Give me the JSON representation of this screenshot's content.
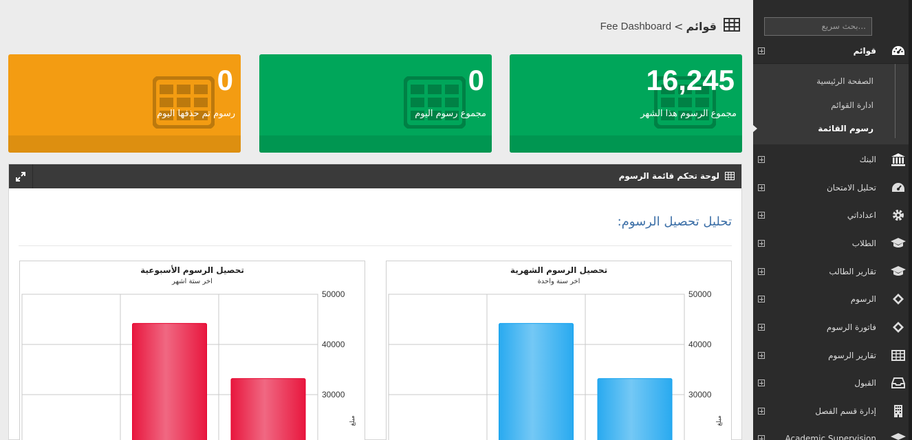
{
  "sidebar": {
    "search_placeholder": "...بحث سريع",
    "dashboard_label": "قوائم",
    "submenu": [
      "الصفحة الرئيسية",
      "ادارة القوائم",
      "رسوم القائمة"
    ],
    "items": [
      {
        "label": "البنك",
        "icon": "bank-icon"
      },
      {
        "label": "تحليل الامتحان",
        "icon": "dashboard-icon"
      },
      {
        "label": "اعداداتي",
        "icon": "gear-icon"
      },
      {
        "label": "الطلاب",
        "icon": "graduation-cap-icon"
      },
      {
        "label": "تقارير الطالب",
        "icon": "graduation-cap-icon"
      },
      {
        "label": "الرسوم",
        "icon": "ticket-icon"
      },
      {
        "label": "فاتورة الرسوم",
        "icon": "ticket-icon"
      },
      {
        "label": "تقارير الرسوم",
        "icon": "table-icon"
      },
      {
        "label": "القبول",
        "icon": "inbox-icon"
      },
      {
        "label": "إدارة قسم الفصل",
        "icon": "building-icon"
      },
      {
        "label": "Academic Supervision",
        "icon": "graduation-cap-icon"
      }
    ]
  },
  "breadcrumb": {
    "section": "قوائم",
    "separator": ">",
    "page": "Fee Dashboard"
  },
  "cards": [
    {
      "value": "16,245",
      "caption": "مجموع الرسوم هذا الشهر",
      "color": "#00a65a"
    },
    {
      "value": "0",
      "caption": "مجموع رسوم اليوم",
      "color": "#00a65a"
    },
    {
      "value": "0",
      "caption": "رسوم تم حذفها اليوم",
      "color": "#f39c12"
    }
  ],
  "panel": {
    "title": "لوحة تحكم قائمة الرسوم",
    "analysis_title": "تحليل تحصيل الرسوم:"
  },
  "chart_data": [
    {
      "type": "bar",
      "title": "تحصيل الرسوم الشهرية",
      "subtitle": "اخر سنة واحدة",
      "ylabel": "مبلغ",
      "yticks": [
        30000,
        40000,
        50000
      ],
      "categories": [
        "",
        ""
      ],
      "values": [
        44200,
        33200
      ],
      "color": "#29aaf0"
    },
    {
      "type": "bar",
      "title": "تحصيل الرسوم الأسبوعية",
      "subtitle": "اخر ستة اشهر",
      "ylabel": "مبلغ",
      "yticks": [
        30000,
        40000,
        50000
      ],
      "categories": [
        "",
        ""
      ],
      "values": [
        44200,
        33200
      ],
      "color": "#e8173e"
    }
  ]
}
